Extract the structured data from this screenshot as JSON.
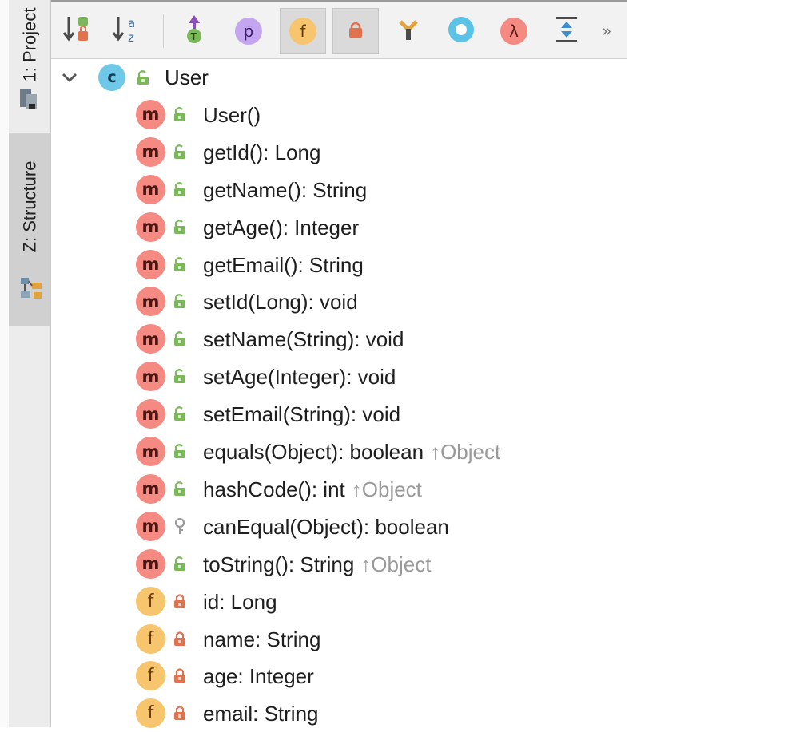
{
  "sidebar": {
    "project_tab": "1: Project",
    "structure_tab": "Z: Structure"
  },
  "toolbar": {
    "buttons": [
      {
        "name": "sort-by-visibility",
        "icon": "sort-visibility-icon"
      },
      {
        "name": "sort-alphabetically",
        "icon": "sort-alpha-icon"
      },
      {
        "name": "show-inherited",
        "icon": "inherited-icon"
      },
      {
        "name": "show-properties",
        "icon": "property-icon",
        "glyph": "p"
      },
      {
        "name": "show-fields",
        "icon": "field-icon",
        "glyph": "f",
        "pressed": true
      },
      {
        "name": "show-non-public",
        "icon": "lock-icon",
        "pressed": true
      },
      {
        "name": "show-interfaces",
        "icon": "interface-icon"
      },
      {
        "name": "show-anonymous",
        "icon": "anonymous-icon"
      },
      {
        "name": "show-lambdas",
        "icon": "lambda-icon",
        "glyph": "λ"
      },
      {
        "name": "expand-all",
        "icon": "expand-all-icon"
      }
    ],
    "more_label": "»"
  },
  "tree": {
    "root": {
      "kind": "c",
      "name": "User",
      "visibility": "public"
    },
    "members": [
      {
        "kind": "m",
        "visibility": "public",
        "signature": "User()",
        "inherited": ""
      },
      {
        "kind": "m",
        "visibility": "public",
        "signature": "getId(): Long",
        "inherited": ""
      },
      {
        "kind": "m",
        "visibility": "public",
        "signature": "getName(): String",
        "inherited": ""
      },
      {
        "kind": "m",
        "visibility": "public",
        "signature": "getAge(): Integer",
        "inherited": ""
      },
      {
        "kind": "m",
        "visibility": "public",
        "signature": "getEmail(): String",
        "inherited": ""
      },
      {
        "kind": "m",
        "visibility": "public",
        "signature": "setId(Long): void",
        "inherited": ""
      },
      {
        "kind": "m",
        "visibility": "public",
        "signature": "setName(String): void",
        "inherited": ""
      },
      {
        "kind": "m",
        "visibility": "public",
        "signature": "setAge(Integer): void",
        "inherited": ""
      },
      {
        "kind": "m",
        "visibility": "public",
        "signature": "setEmail(String): void",
        "inherited": ""
      },
      {
        "kind": "m",
        "visibility": "public",
        "signature": "equals(Object): boolean",
        "inherited": "Object"
      },
      {
        "kind": "m",
        "visibility": "public",
        "signature": "hashCode(): int",
        "inherited": "Object"
      },
      {
        "kind": "m",
        "visibility": "protected",
        "signature": "canEqual(Object): boolean",
        "inherited": ""
      },
      {
        "kind": "m",
        "visibility": "public",
        "signature": "toString(): String",
        "inherited": "Object"
      },
      {
        "kind": "f",
        "visibility": "private",
        "signature": "id: Long",
        "inherited": ""
      },
      {
        "kind": "f",
        "visibility": "private",
        "signature": "name: String",
        "inherited": ""
      },
      {
        "kind": "f",
        "visibility": "private",
        "signature": "age: Integer",
        "inherited": ""
      },
      {
        "kind": "f",
        "visibility": "private",
        "signature": "email: String",
        "inherited": ""
      }
    ]
  },
  "colors": {
    "method_badge": "#f58a82",
    "field_badge": "#f6c56d",
    "class_badge": "#6fc8e8",
    "public_access": "#7ab85a",
    "private_access": "#e0734e",
    "inherited_text": "#9a9a9a"
  }
}
